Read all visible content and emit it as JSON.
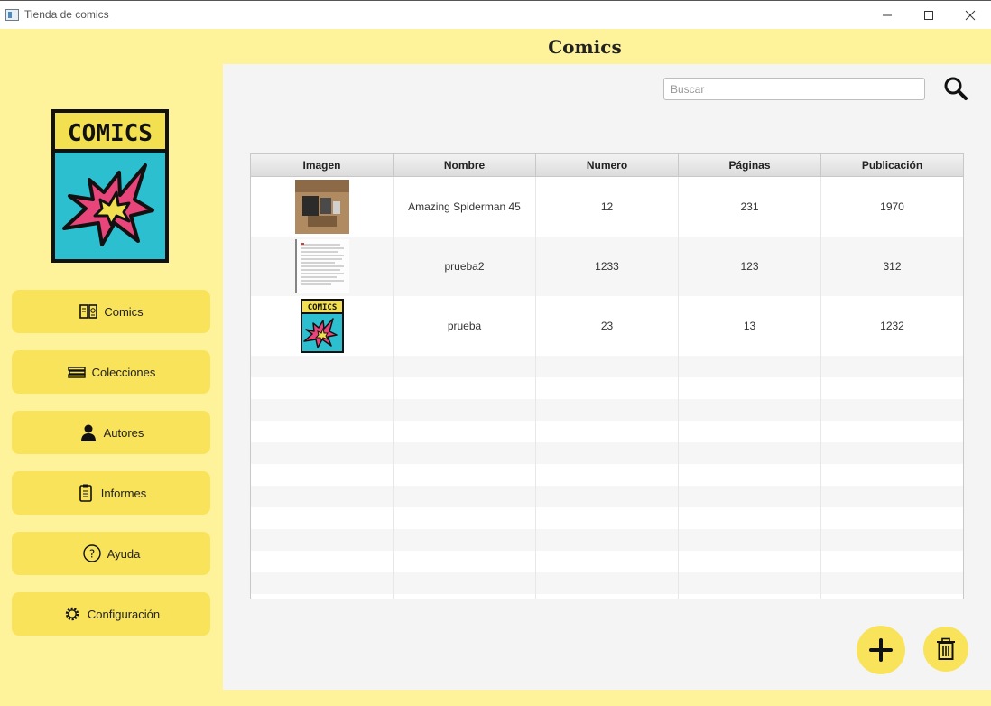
{
  "window": {
    "title": "Tienda de comics"
  },
  "header": {
    "title": "Comics"
  },
  "logo": {
    "text": "COMICS"
  },
  "sidebar": {
    "items": [
      {
        "label": "Comics",
        "icon": "book-open-icon"
      },
      {
        "label": "Colecciones",
        "icon": "stack-icon"
      },
      {
        "label": "Autores",
        "icon": "person-icon"
      },
      {
        "label": "Informes",
        "icon": "clipboard-icon"
      },
      {
        "label": "Ayuda",
        "icon": "help-icon"
      },
      {
        "label": "Configuración",
        "icon": "gear-icon"
      }
    ]
  },
  "search": {
    "placeholder": "Buscar",
    "value": ""
  },
  "table": {
    "columns": [
      "Imagen",
      "Nombre",
      "Numero",
      "Páginas",
      "Publicación"
    ],
    "rows": [
      {
        "image": "photo-thumbnail",
        "nombre": "Amazing Spiderman 45",
        "numero": "12",
        "paginas": "231",
        "publicacion": "1970"
      },
      {
        "image": "document-thumbnail",
        "nombre": "prueba2",
        "numero": "1233",
        "paginas": "123",
        "publicacion": "312"
      },
      {
        "image": "comics-logo-thumbnail",
        "nombre": "prueba",
        "numero": "23",
        "paginas": "13",
        "publicacion": "1232"
      }
    ]
  },
  "colors": {
    "sidebar_bg": "#fef39b",
    "button_bg": "#f9e35a",
    "main_bg": "#f4f4f4"
  }
}
